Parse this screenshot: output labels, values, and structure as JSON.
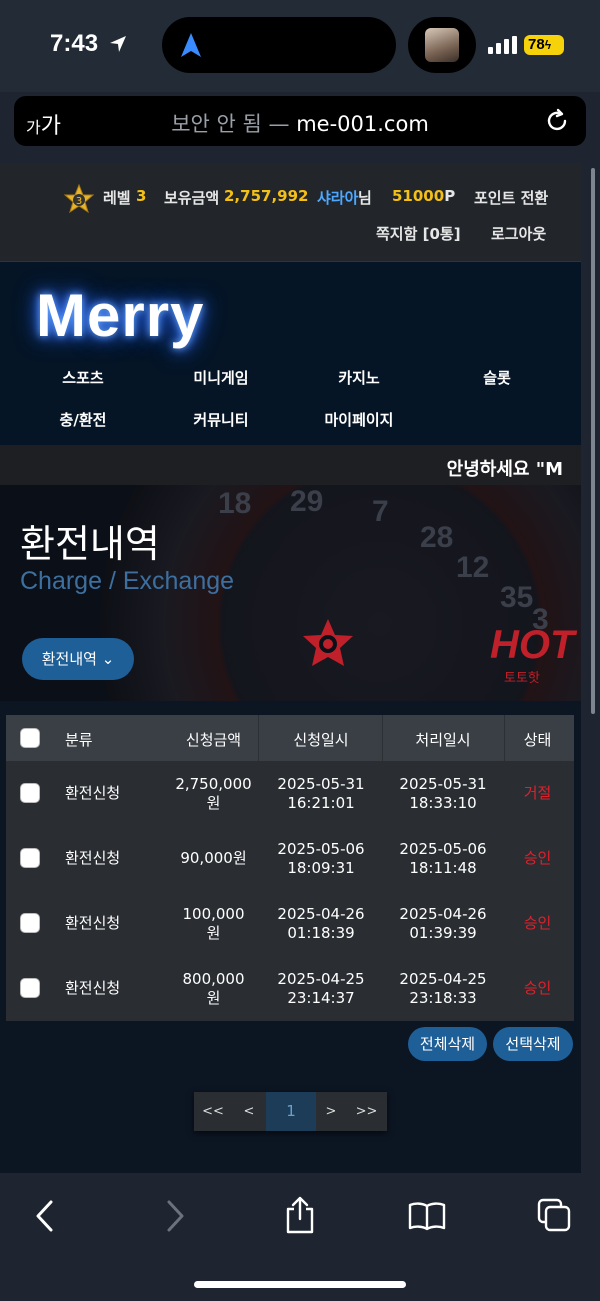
{
  "status": {
    "time": "7:43",
    "battery": "78"
  },
  "browser": {
    "aa_small": "가",
    "aa_big": "가",
    "url_insecure": "보안 안 됨 —",
    "url_host": "me-001.com"
  },
  "topbar": {
    "level_label": "레벨",
    "level_value": "3",
    "level_badge": "3",
    "balance_label": "보유금액",
    "balance_value": "2,757,992",
    "user_name": "샤라아",
    "user_suffix": "님",
    "points": "51000",
    "points_unit": "P",
    "point_convert": "포인트 전환",
    "messages": "쪽지함 [0통]",
    "logout": "로그아웃"
  },
  "nav": {
    "logo": "Merry",
    "items": [
      "스포츠",
      "미니게임",
      "카지노",
      "슬롯",
      "충/환전",
      "커뮤니티",
      "마이페이지"
    ]
  },
  "greeting": "안녕하세요 \"M",
  "banner": {
    "title": "환전내역",
    "subtitle": "Charge / Exchange",
    "dropdown": "환전내역",
    "hot": "HOT",
    "hot_sub": "토토핫",
    "wheel_numbers": [
      "18",
      "29",
      "7",
      "28",
      "12",
      "35",
      "3"
    ]
  },
  "table": {
    "headers": [
      "분류",
      "신청금액",
      "신청일시",
      "처리일시",
      "상태"
    ],
    "rows": [
      {
        "type": "환전신청",
        "amount_1": "2,750,000",
        "amount_2": "원",
        "req_date": "2025-05-31",
        "req_time": "16:21:01",
        "proc_date": "2025-05-31",
        "proc_time": "18:33:10",
        "status": "거절"
      },
      {
        "type": "환전신청",
        "amount_1": "90,000원",
        "amount_2": "",
        "req_date": "2025-05-06",
        "req_time": "18:09:31",
        "proc_date": "2025-05-06",
        "proc_time": "18:11:48",
        "status": "승인"
      },
      {
        "type": "환전신청",
        "amount_1": "100,000",
        "amount_2": "원",
        "req_date": "2025-04-26",
        "req_time": "01:18:39",
        "proc_date": "2025-04-26",
        "proc_time": "01:39:39",
        "status": "승인"
      },
      {
        "type": "환전신청",
        "amount_1": "800,000",
        "amount_2": "원",
        "req_date": "2025-04-25",
        "req_time": "23:14:37",
        "proc_date": "2025-04-25",
        "proc_time": "23:18:33",
        "status": "승인"
      }
    ]
  },
  "actions": {
    "delete_all": "전체삭제",
    "delete_selected": "선택삭제"
  },
  "pager": {
    "first": "<<",
    "prev": "<",
    "current": "1",
    "next": ">",
    "last": ">>"
  },
  "colors": {
    "accent": "#1f5f98",
    "gold": "#f5c016",
    "link_blue": "#4ea8ff",
    "status_red": "#e0202a"
  }
}
